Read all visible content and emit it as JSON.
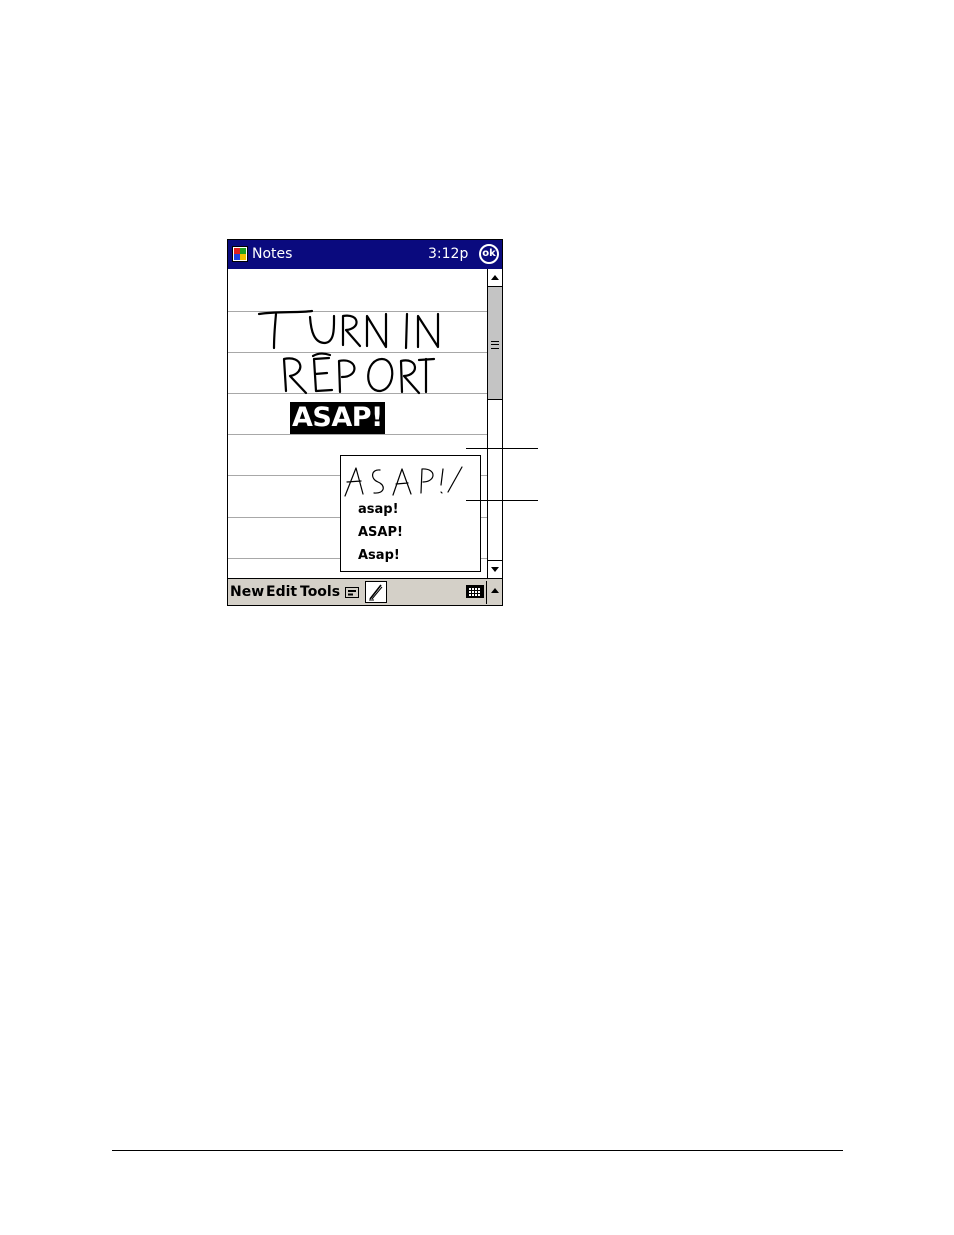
{
  "titlebar": {
    "app_title": "Notes",
    "clock": "3:12p",
    "ok_label": "ok"
  },
  "note": {
    "handwritten_lines": [
      "TURN IN",
      "REPORT"
    ],
    "selected_word": "ASAP!"
  },
  "recognizer_popup": {
    "ink_sample": "ASAP!",
    "alternates": [
      "asap!",
      "ASAP!",
      "Asap!"
    ]
  },
  "menubar": {
    "items": [
      "New",
      "Edit",
      "Tools"
    ],
    "icons": [
      "recording-toolbar-icon",
      "pen-icon",
      "keyboard-icon",
      "sip-arrow-icon"
    ]
  },
  "colors": {
    "titlebar": "#0a0a7e",
    "menubar": "#d4d0c8",
    "ruled_line": "#a8a8a8",
    "scroll_thumb": "#c4c4c4"
  }
}
